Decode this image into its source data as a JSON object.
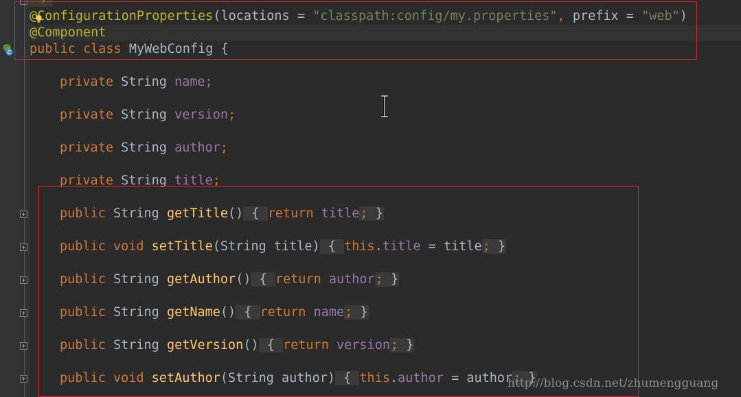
{
  "editor": {
    "comment_tail": "*/",
    "lines": {
      "l1": {
        "ann": "@ConfigurationProperties",
        "open": "(",
        "p1": "locations",
        "eq1": " = ",
        "s1": "\"classpath:config/my.properties\"",
        "comma": ", ",
        "p2": "prefix",
        "eq2": " = ",
        "s2": "\"web\"",
        "close": ")"
      },
      "l2": {
        "ann": "@Component"
      },
      "l3": {
        "kw1": "public",
        "kw2": "class",
        "name": "MyWebConfig",
        "brace": "{"
      },
      "f1": {
        "kw": "private",
        "type": "String",
        "name": "name",
        "semi": ";"
      },
      "f2": {
        "kw": "private",
        "type": "String",
        "name": "version",
        "semi": ";"
      },
      "f3": {
        "kw": "private",
        "type": "String",
        "name": "author",
        "semi": ";"
      },
      "f4": {
        "kw": "private",
        "type": "String",
        "name": "title",
        "semi": ";"
      },
      "m1": {
        "kw": "public",
        "type": "String",
        "name": "getTitle",
        "params": "()",
        "ob": "{",
        "ret": "return",
        "field": "title",
        "semi": ";",
        "cb": "}"
      },
      "m2": {
        "kw": "public",
        "type": "void",
        "name": "setTitle",
        "params": "(String title)",
        "ob": "{",
        "this": "this",
        "dot": ".",
        "field": "title",
        "assign": " = title",
        "semi": ";",
        "cb": "}"
      },
      "m3": {
        "kw": "public",
        "type": "String",
        "name": "getAuthor",
        "params": "()",
        "ob": "{",
        "ret": "return",
        "field": "author",
        "semi": ";",
        "cb": "}"
      },
      "m4": {
        "kw": "public",
        "type": "String",
        "name": "getName",
        "params": "()",
        "ob": "{",
        "ret": "return",
        "field": "name",
        "semi": ";",
        "cb": "}"
      },
      "m5": {
        "kw": "public",
        "type": "String",
        "name": "getVersion",
        "params": "()",
        "ob": "{",
        "ret": "return",
        "field": "version",
        "semi": ";",
        "cb": "}"
      },
      "m6": {
        "kw": "public",
        "type": "void",
        "name": "setAuthor",
        "params": "(String author)",
        "ob": "{",
        "this": "this",
        "dot": ".",
        "field": "author",
        "assign": " = author",
        "semi": ";",
        "cb": "}"
      }
    }
  },
  "watermark": "http://blog.csdn.net/zhumengguang",
  "colors": {
    "background": "#2b2b2b",
    "keyword": "#cc7832",
    "annotation": "#bbb529",
    "string": "#6a8759",
    "field": "#9876aa",
    "method": "#ffc66d",
    "highlight_box": "#d42a2a"
  },
  "icons": {
    "gutter": "spring-bean-icon",
    "intention": "lightbulb-icon",
    "pointer": "text-cursor-icon"
  }
}
